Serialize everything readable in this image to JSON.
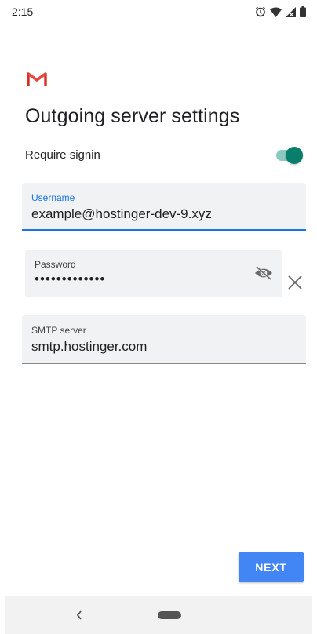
{
  "status_bar": {
    "time": "2:15",
    "icons": [
      "alarm-icon",
      "wifi-icon",
      "signal-icon",
      "battery-icon"
    ]
  },
  "app": {
    "logo": "gmail-logo",
    "title": "Outgoing server settings"
  },
  "require_signin": {
    "label": "Require signin",
    "enabled": true
  },
  "fields": {
    "username": {
      "label": "Username",
      "value": "example@hostinger-dev-9.xyz",
      "focused": true
    },
    "password": {
      "label": "Password",
      "value": "•••••••••••••",
      "visibility_icon": "eye-off-icon",
      "clear_icon": "close-icon"
    },
    "smtp_server": {
      "label": "SMTP server",
      "value": "smtp.hostinger.com"
    }
  },
  "actions": {
    "next_label": "NEXT"
  },
  "colors": {
    "accent": "#1a73e8",
    "next_button": "#4285f4",
    "toggle_on": "#077f6b",
    "gmail_red": "#d93025"
  }
}
